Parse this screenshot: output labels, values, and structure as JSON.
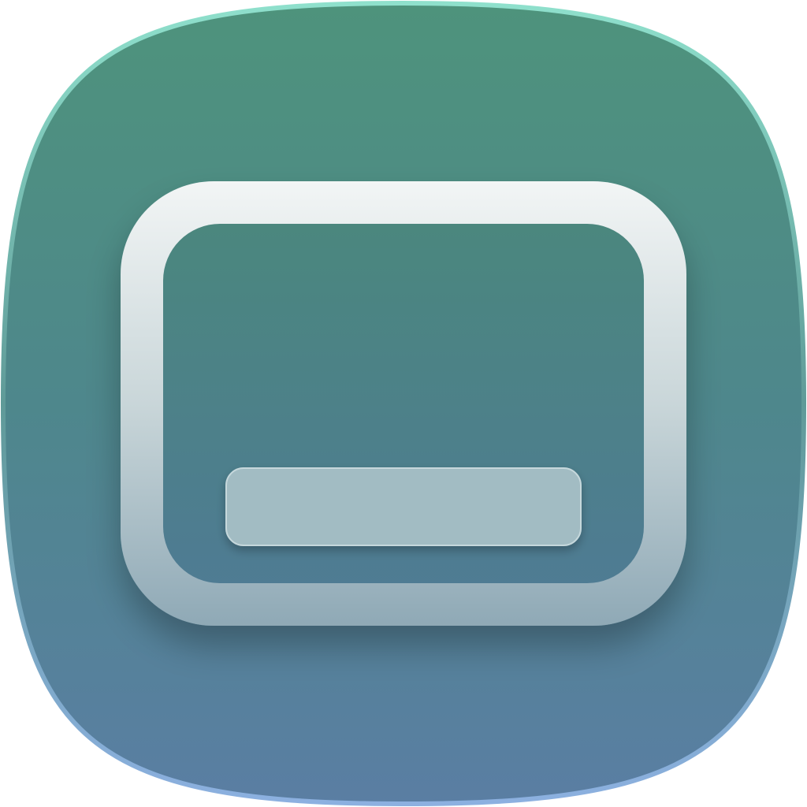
{
  "icon": {
    "name": "app-icon",
    "symbol": "window-with-bottom-bar-icon",
    "colors": {
      "tile_top": "#4e937c",
      "tile_mid": "#4e878c",
      "tile_bottom": "#5a7ea3",
      "tile_rim": "#8fd3c7",
      "frame_top": "#f2f5f5",
      "frame_bottom": "#8fa9b6",
      "bar_fill": "#a2bcc3"
    }
  }
}
